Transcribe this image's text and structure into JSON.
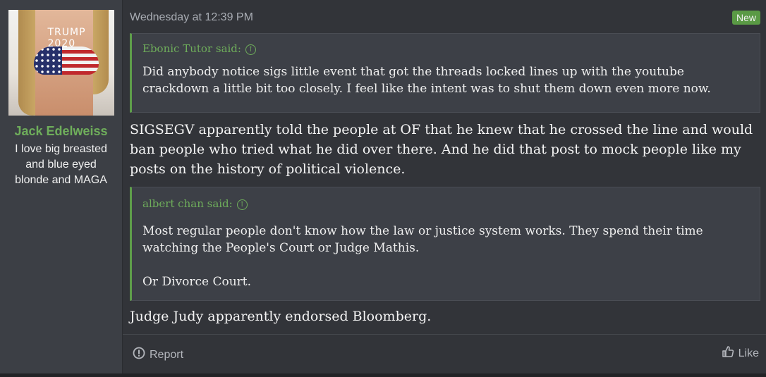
{
  "user": {
    "name": "Jack Edelweiss",
    "title": "I love big breasted and blue eyed blonde and MAGA",
    "avatar_scribble": "TRUMP 2020"
  },
  "post": {
    "timestamp": "Wednesday at 12:39 PM",
    "badge": "New",
    "quote1": {
      "author": "Ebonic Tutor said:",
      "text": "Did anybody notice sigs little event that got the threads locked lines up with the youtube crackdown a little bit too closely. I feel like the intent was to shut them down even more now."
    },
    "paragraph1": "SIGSEGV apparently told the people at OF that he knew that he crossed the line and would ban people who tried what he did over there. And he did that post to mock people like my posts on the history of political violence.",
    "quote2": {
      "author": "albert chan said:",
      "text_line1": "Most regular people don't know how the law or justice system works. They spend their time watching the People's Court or Judge Mathis.",
      "text_line2": "Or Divorce Court."
    },
    "paragraph2": "Judge Judy apparently endorsed Bloomberg."
  },
  "footer": {
    "report_label": "Report",
    "like_label": "Like"
  },
  "colors": {
    "accent": "#6fae5b",
    "background": "#323439",
    "user_cell": "#3c3f45"
  }
}
